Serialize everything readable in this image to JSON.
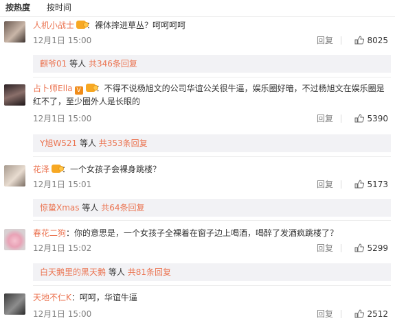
{
  "tabs": {
    "hot": "按热度",
    "time": "按时间"
  },
  "comments": [
    {
      "username": "人机小战士",
      "text": "裸体摔进草丛？呵呵呵呵",
      "time": "12月1日 15:00",
      "reply_label": "回复",
      "likes": "8025",
      "sub_user": "麒爷01",
      "sub_mid": "等人",
      "sub_count": "共346条回复"
    },
    {
      "username": "占卜师Ella",
      "text": "不得不说杨旭文的公司华谊公关很牛逼，娱乐圈好暗，不过杨旭文在娱乐圈是红不了，至少圈外人是长眼的",
      "time": "12月1日 15:00",
      "reply_label": "回复",
      "likes": "5390",
      "sub_user": "Y旭W521",
      "sub_mid": "等人",
      "sub_count": "共353条回复"
    },
    {
      "username": "花泽",
      "text": "一个女孩子会裸身跳楼？",
      "time": "12月1日 15:01",
      "reply_label": "回复",
      "likes": "5173",
      "sub_user": "惊蛰Xmas",
      "sub_mid": "等人",
      "sub_count": "共64条回复"
    },
    {
      "username": "春花二狗",
      "text": "你的意思是，一个女孩子全裸着在窗子边上喝酒，喝醉了发酒疯跳楼了？",
      "time": "12月1日 15:02",
      "reply_label": "回复",
      "likes": "5299",
      "sub_user": "白天鹅里的黑天鹅",
      "sub_mid": "等人",
      "sub_count": "共81条回复"
    },
    {
      "username": "天地不仁K",
      "text": "呵呵，华谊牛逼",
      "time": "12月1日 15:00",
      "reply_label": "回复",
      "likes": "2512"
    }
  ],
  "colors": {
    "link": "#eb7350",
    "meta": "#808080",
    "subbox_bg": "#f2f2f5"
  },
  "icons": {
    "like": "thumbs-up-icon",
    "vip": "crown-badge-icon",
    "verified": "v-badge-icon"
  }
}
